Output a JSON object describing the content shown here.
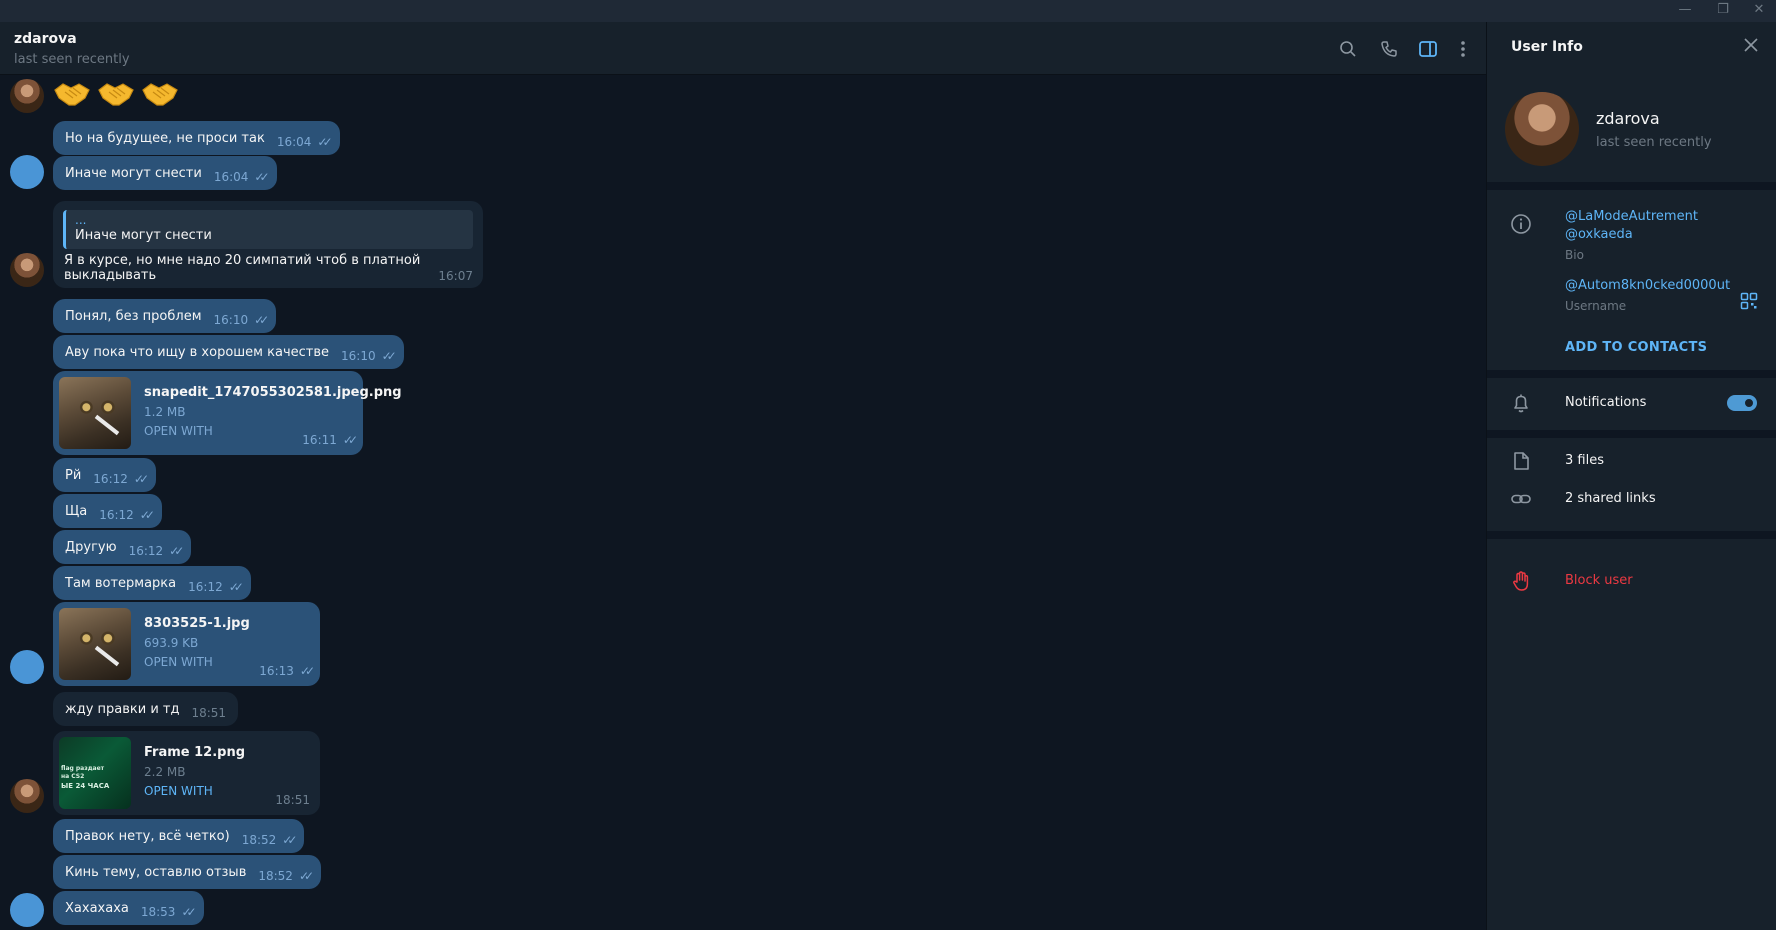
{
  "window": {
    "minimize_glyph": "—",
    "restore_glyph": "❐",
    "close_glyph": "✕"
  },
  "header": {
    "title": "zdarova",
    "status": "last seen recently",
    "icons": [
      "search-icon",
      "phone-icon",
      "sidebar-toggle-icon",
      "more-vertical-icon"
    ]
  },
  "messages": [
    {
      "type": "emoji",
      "emoji_icons": [
        "handshake-icon",
        "handshake-icon",
        "handshake-icon"
      ]
    },
    {
      "type": "text",
      "direction": "out",
      "text": "Но на будущее, не проси так",
      "time": "16:04",
      "read": true
    },
    {
      "type": "text",
      "direction": "out",
      "text": "Иначе могут снести",
      "time": "16:04",
      "read": true
    },
    {
      "type": "reply",
      "direction": "in",
      "quote_dots": "...",
      "quote_text": "Иначе могут снести",
      "text": "Я в курсе, но мне надо 20 симпатий чтоб в платной выкладывать",
      "time": "16:07"
    },
    {
      "type": "text",
      "direction": "out",
      "text": "Понял, без проблем",
      "time": "16:10",
      "read": true
    },
    {
      "type": "text",
      "direction": "out",
      "text": "Аву пока что ищу в хорошем качестве",
      "time": "16:10",
      "read": true
    },
    {
      "type": "file",
      "direction": "out",
      "name": "snapedit_1747055302581.jpeg.png",
      "size": "1.2 MB",
      "action": "OPEN WITH",
      "time": "16:11",
      "read": true
    },
    {
      "type": "text",
      "direction": "out",
      "text": "Рй",
      "time": "16:12",
      "read": true
    },
    {
      "type": "text",
      "direction": "out",
      "text": "Ща",
      "time": "16:12",
      "read": true
    },
    {
      "type": "text",
      "direction": "out",
      "text": "Другую",
      "time": "16:12",
      "read": true
    },
    {
      "type": "text",
      "direction": "out",
      "text": "Там вотермарка",
      "time": "16:12",
      "read": true
    },
    {
      "type": "file",
      "direction": "out",
      "name": "8303525-1.jpg",
      "size": "693.9 KB",
      "action": "OPEN WITH",
      "time": "16:13",
      "read": true
    },
    {
      "type": "text",
      "direction": "in",
      "text": "жду правки и тд",
      "time": "18:51"
    },
    {
      "type": "file",
      "direction": "in",
      "name": "Frame 12.png",
      "size": "2.2 MB",
      "action": "OPEN WITH",
      "time": "18:51",
      "thumb_lines": [
        "flag раздает",
        "на CS2",
        "ЫЕ 24 ЧАСА"
      ]
    },
    {
      "type": "text",
      "direction": "out",
      "text": "Правок нету, всё четко)",
      "time": "18:52",
      "read": true
    },
    {
      "type": "text",
      "direction": "out",
      "text": "Кинь тему, оставлю отзыв",
      "time": "18:52",
      "read": true
    },
    {
      "type": "text",
      "direction": "out",
      "text": "Хахахаха",
      "time": "18:53",
      "read": true
    }
  ],
  "ticks_glyph": "✓✓",
  "info": {
    "title": "User Info",
    "name": "zdarova",
    "status": "last seen recently",
    "bio_line1": "@LaModeAutrement",
    "bio_line2": "@oxkaeda",
    "bio_label": "Bio",
    "username": "@Autom8kn0cked0000ut",
    "username_label": "Username",
    "add_contacts": "ADD TO CONTACTS",
    "notifications_label": "Notifications",
    "notifications_on": true,
    "files": "3 files",
    "links": "2 shared links",
    "block": "Block user"
  },
  "colors": {
    "background": "#0e1621",
    "panel": "#17212b",
    "outgoing_bubble": "#2b5278",
    "incoming_bubble": "#182533",
    "accent": "#5eb5f7",
    "danger": "#ec3942"
  }
}
